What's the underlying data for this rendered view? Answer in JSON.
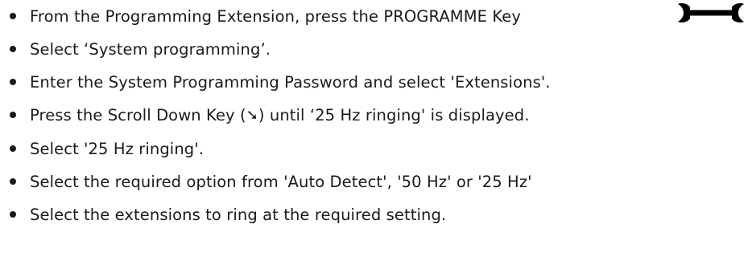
{
  "steps": [
    {
      "text": "From the Programming Extension, press the PROGRAMME Key"
    },
    {
      "text": "Select ‘System programming’."
    },
    {
      "text": "Enter the System Programming Password and select 'Extensions'."
    },
    {
      "before": "Press the Scroll Down Key (",
      "glyph": "➘",
      "after": ") until ‘25 Hz ringing' is displayed."
    },
    {
      "text": "Select '25 Hz ringing'."
    },
    {
      "text": "Select the required option from 'Auto Detect', '50 Hz' or '25 Hz'"
    },
    {
      "text": "Select the extensions to ring at the required setting."
    }
  ],
  "icons": {
    "wrench": "wrench-icon",
    "scroll_down_key": "arrow-down-right-icon"
  }
}
